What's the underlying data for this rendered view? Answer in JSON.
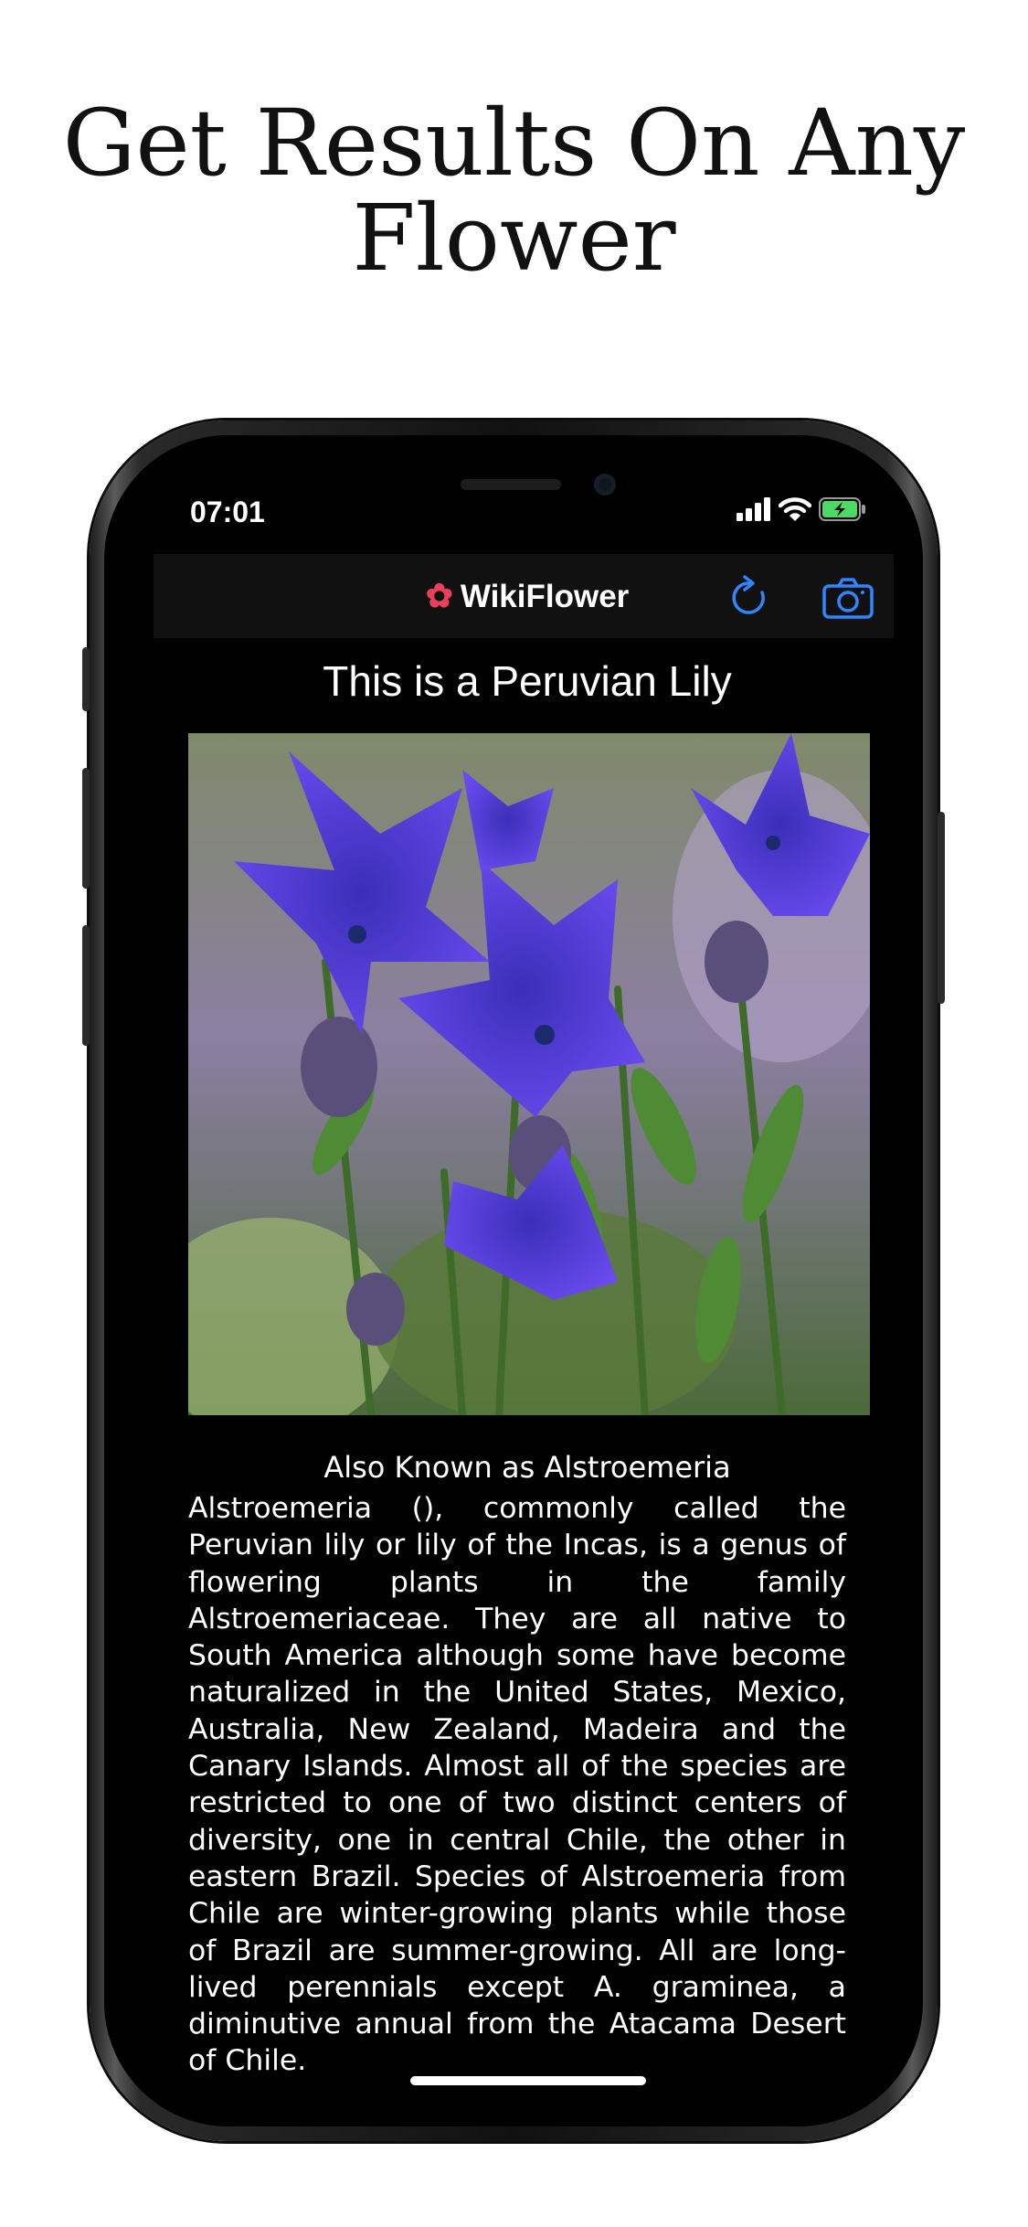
{
  "headline": {
    "line1": "Get Results On Any",
    "line2": "Flower"
  },
  "status_bar": {
    "time": "07:01"
  },
  "app": {
    "name": "WikiFlower",
    "icons": {
      "logo": "hibiscus-icon",
      "refresh": "refresh-icon",
      "camera": "camera-icon"
    },
    "accent_color": "#2f86ff"
  },
  "result": {
    "title": "This is a Peruvian Lily",
    "also_known_as": "Also Known as Alstroemeria",
    "description": "Alstroemeria (), commonly called the Peruvian lily or lily of the Incas, is a genus of flowering plants in the family Alstroemeriaceae. They are all native to South America although some have become naturalized in the United States, Mexico, Australia, New Zealand, Madeira and the Canary Islands. Almost all of the species are restricted to one of two distinct centers of diversity, one in central Chile, the other in eastern Brazil. Species of Alstroemeria from Chile are winter-growing plants while those of Brazil are summer-growing. All are long-lived perennials except A. graminea, a diminutive annual from the Atacama Desert of Chile."
  }
}
